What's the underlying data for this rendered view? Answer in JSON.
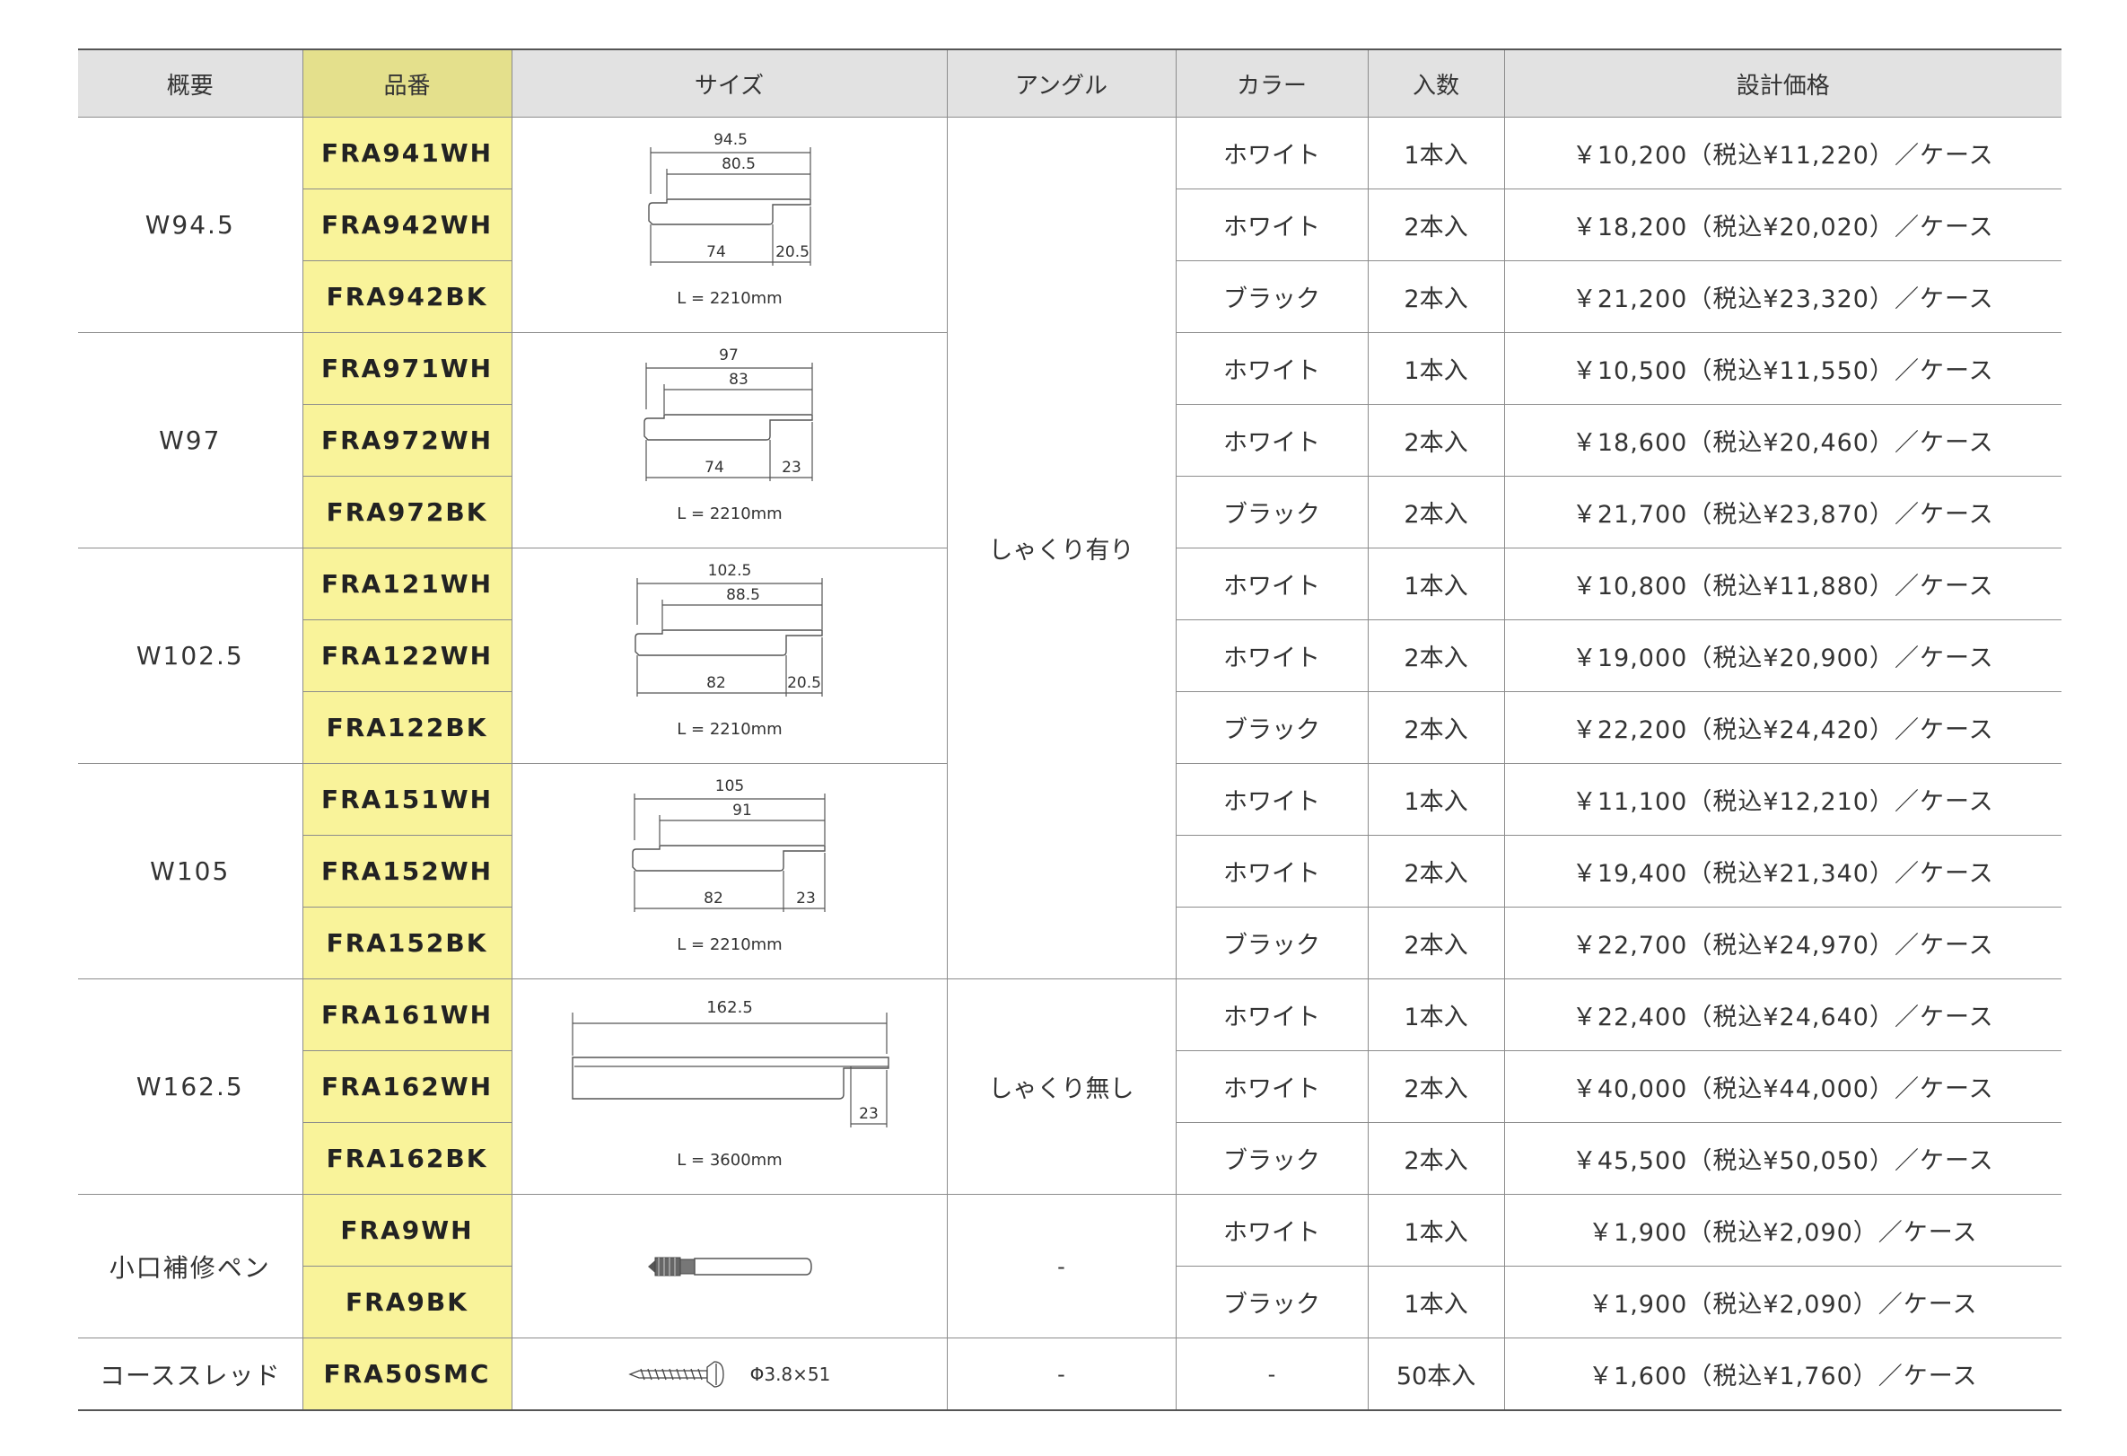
{
  "headers": {
    "summary": "概要",
    "part_no": "品番",
    "size": "サイズ",
    "angle": "アングル",
    "color": "カラー",
    "qty": "入数",
    "price": "設計価格"
  },
  "groups": [
    {
      "summary": "W94.5",
      "drawing": {
        "overall": "94.5",
        "inner": "80.5",
        "base": "74",
        "side": "20.5",
        "length": "L = 2210mm"
      },
      "rows": [
        {
          "part_no": "FRA941WH",
          "color": "ホワイト",
          "qty": "1本入",
          "price": "￥10,200（税込¥11,220）／ケース"
        },
        {
          "part_no": "FRA942WH",
          "color": "ホワイト",
          "qty": "2本入",
          "price": "￥18,200（税込¥20,020）／ケース"
        },
        {
          "part_no": "FRA942BK",
          "color": "ブラック",
          "qty": "2本入",
          "price": "￥21,200（税込¥23,320）／ケース"
        }
      ]
    },
    {
      "summary": "W97",
      "drawing": {
        "overall": "97",
        "inner": "83",
        "base": "74",
        "side": "23",
        "length": "L = 2210mm"
      },
      "rows": [
        {
          "part_no": "FRA971WH",
          "color": "ホワイト",
          "qty": "1本入",
          "price": "￥10,500（税込¥11,550）／ケース"
        },
        {
          "part_no": "FRA972WH",
          "color": "ホワイト",
          "qty": "2本入",
          "price": "￥18,600（税込¥20,460）／ケース"
        },
        {
          "part_no": "FRA972BK",
          "color": "ブラック",
          "qty": "2本入",
          "price": "￥21,700（税込¥23,870）／ケース"
        }
      ]
    },
    {
      "summary": "W102.5",
      "drawing": {
        "overall": "102.5",
        "inner": "88.5",
        "base": "82",
        "side": "20.5",
        "length": "L = 2210mm"
      },
      "rows": [
        {
          "part_no": "FRA121WH",
          "color": "ホワイト",
          "qty": "1本入",
          "price": "￥10,800（税込¥11,880）／ケース"
        },
        {
          "part_no": "FRA122WH",
          "color": "ホワイト",
          "qty": "2本入",
          "price": "￥19,000（税込¥20,900）／ケース"
        },
        {
          "part_no": "FRA122BK",
          "color": "ブラック",
          "qty": "2本入",
          "price": "￥22,200（税込¥24,420）／ケース"
        }
      ]
    },
    {
      "summary": "W105",
      "drawing": {
        "overall": "105",
        "inner": "91",
        "base": "82",
        "side": "23",
        "length": "L = 2210mm"
      },
      "rows": [
        {
          "part_no": "FRA151WH",
          "color": "ホワイト",
          "qty": "1本入",
          "price": "￥11,100（税込¥12,210）／ケース"
        },
        {
          "part_no": "FRA152WH",
          "color": "ホワイト",
          "qty": "2本入",
          "price": "￥19,400（税込¥21,340）／ケース"
        },
        {
          "part_no": "FRA152BK",
          "color": "ブラック",
          "qty": "2本入",
          "price": "￥22,700（税込¥24,970）／ケース"
        }
      ]
    },
    {
      "summary": "W162.5",
      "drawing": {
        "overall": "162.5",
        "side": "23",
        "length": "L = 3600mm"
      },
      "rows": [
        {
          "part_no": "FRA161WH",
          "color": "ホワイト",
          "qty": "1本入",
          "price": "￥22,400（税込¥24,640）／ケース"
        },
        {
          "part_no": "FRA162WH",
          "color": "ホワイト",
          "qty": "2本入",
          "price": "￥40,000（税込¥44,000）／ケース"
        },
        {
          "part_no": "FRA162BK",
          "color": "ブラック",
          "qty": "2本入",
          "price": "￥45,500（税込¥50,050）／ケース"
        }
      ]
    },
    {
      "summary": "小口補修ペン",
      "rows": [
        {
          "part_no": "FRA9WH",
          "color": "ホワイト",
          "qty": "1本入",
          "price": "￥1,900（税込¥2,090）／ケース"
        },
        {
          "part_no": "FRA9BK",
          "color": "ブラック",
          "qty": "1本入",
          "price": "￥1,900（税込¥2,090）／ケース"
        }
      ]
    },
    {
      "summary": "コーススレッド",
      "screw_size": "Φ3.8×51",
      "rows": [
        {
          "part_no": "FRA50SMC",
          "color": "-",
          "qty": "50本入",
          "price": "￥1,600（税込¥1,760）／ケース"
        }
      ]
    }
  ],
  "angles": {
    "with_groove": "しゃくり有り",
    "without_groove": "しゃくり無し",
    "pen": "-",
    "screw": "-"
  }
}
